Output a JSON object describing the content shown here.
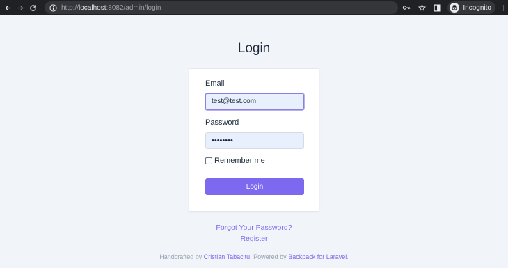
{
  "browser": {
    "url_scheme": "http://",
    "url_host": "localhost",
    "url_rest": ":8082/admin/login",
    "profile_label": "Incognito"
  },
  "page": {
    "title": "Login"
  },
  "form": {
    "email_label": "Email",
    "email_value": "test@test.com",
    "password_label": "Password",
    "password_value": "••••••••",
    "remember_label": "Remember me",
    "remember_checked": false,
    "submit_label": "Login"
  },
  "links": {
    "forgot_password": "Forgot Your Password?",
    "register": "Register"
  },
  "footer": {
    "prefix": "Handcrafted by",
    "author": "Cristian Tabacitu",
    "middle": ". Powered by",
    "product": "Backpack for Laravel",
    "suffix": "."
  },
  "colors": {
    "accent": "#7c69ef",
    "page_bg": "#f1f4f8",
    "input_bg": "#e8f0fe"
  }
}
